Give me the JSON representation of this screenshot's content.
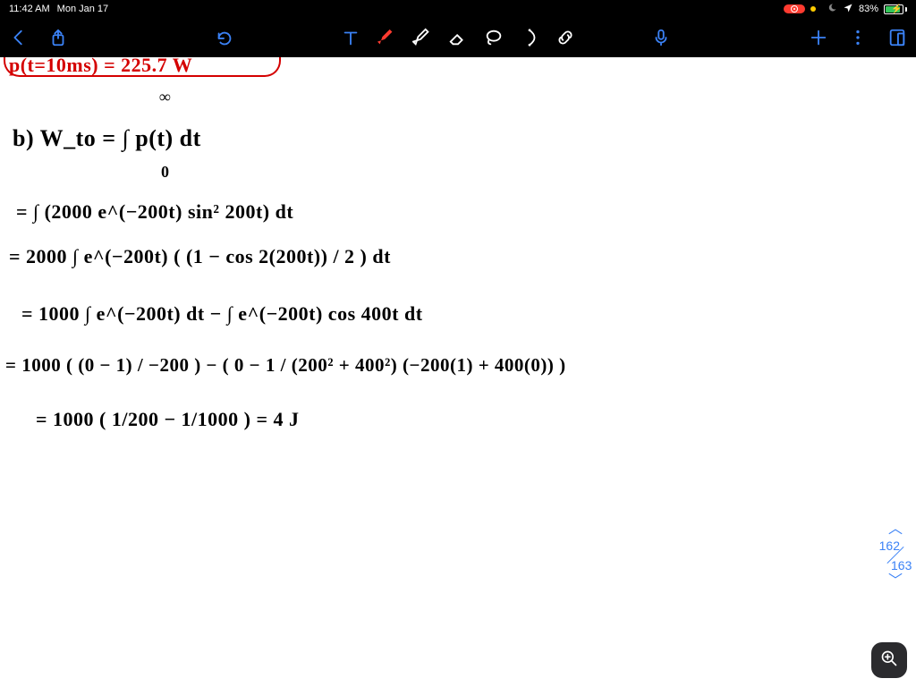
{
  "status": {
    "time": "11:42 AM",
    "date": "Mon Jan 17",
    "battery_pct": "83%",
    "battery_fill_pct": 83
  },
  "pager": {
    "current": "162",
    "total": "163"
  },
  "icons": {
    "back": "back-chevron-icon",
    "share": "share-icon",
    "undo": "undo-icon",
    "text_tool": "text-tool-icon",
    "pen_fill": "pen-fill-icon",
    "pen_outline": "pen-outline-icon",
    "eraser": "eraser-icon",
    "lasso": "lasso-icon",
    "shape": "shape-tool-icon",
    "link": "link-tool-icon",
    "mic": "mic-icon",
    "add": "plus-icon",
    "more": "more-vertical-icon",
    "page_layout": "page-layout-icon",
    "zoom": "zoom-in-icon",
    "rec": "record-icon",
    "dnd": "do-not-disturb-icon",
    "wifi": "wifi-icon",
    "moon": "moon-icon",
    "location": "location-icon",
    "battery": "battery-charging-icon",
    "chev_up": "chevron-up-icon",
    "chev_down": "chevron-down-icon"
  },
  "handwriting": {
    "line_boxed": "p(t=10ms) = 225.7 W",
    "line_inf": "∞",
    "line_b": "b)  W_to  =  ∫ p(t) dt",
    "line_b_zero": "0",
    "line_c": "= ∫ (2000 e^(−200t) sin² 200t) dt",
    "line_d": "= 2000 ∫ e^(−200t) ( (1 − cos 2(200t)) / 2 ) dt",
    "line_e": "= 1000 ∫ e^(−200t) dt  −  ∫ e^(−200t) cos 400t dt",
    "line_f": "= 1000 ( (0 − 1) / −200 )  −  ( 0  −  1 / (200² + 400²)  (−200(1) + 400(0)) )",
    "line_g": "= 1000  ( 1/200  −  1/1000 )   =   4 J"
  }
}
